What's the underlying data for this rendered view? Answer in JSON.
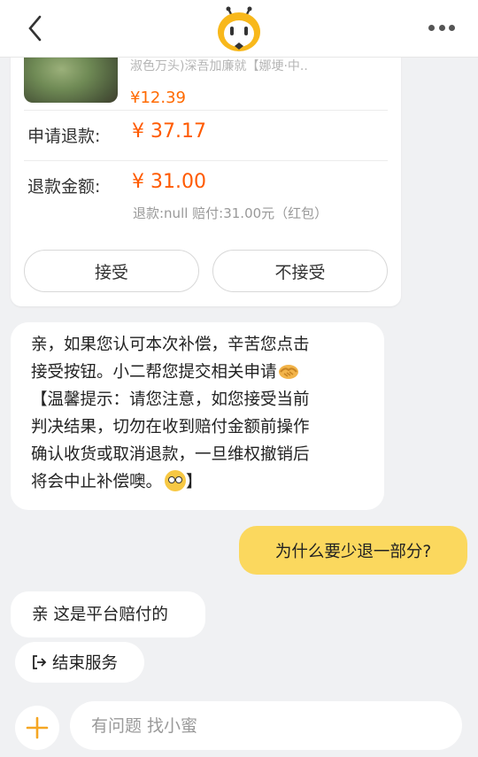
{
  "header": {
    "back_icon": "chevron-left-icon",
    "mascot_icon": "xiaomi-mascot-icon",
    "more_icon": "more-dots-icon"
  },
  "refund_card": {
    "product_title": "淑色万头)深吾加廉就【娜埂·中..",
    "product_price": "¥12.39",
    "apply_label": "申请退款:",
    "apply_value": "¥ 37.17",
    "amount_label": "退款金额:",
    "amount_value": "¥ 31.00",
    "amount_note": "退款:null 赔付:31.00元（红包）",
    "accept_label": "接受",
    "reject_label": "不接受"
  },
  "messages": {
    "bot_1_line_1": "亲，如果您认可本次补偿，辛苦您点击",
    "bot_1_line_2": "接受按钮。小二帮您提交相关申请",
    "bot_1_line_3": "【温馨提示：请您注意，如您接受当前",
    "bot_1_line_4": "判决结果，切勿在收到赔付金额前操作",
    "bot_1_line_5": "确认收货或取消退款，一旦维权撤销后",
    "bot_1_line_6": "将会中止补偿噢。",
    "bot_1_close": "】",
    "user_1": "为什么要少退一部分?",
    "bot_2": "亲 这是平台赔付的"
  },
  "end_service": {
    "label": "结束服务",
    "icon": "exit-icon"
  },
  "input_bar": {
    "placeholder": "有问题 找小蜜",
    "plus_icon": "plus-icon"
  },
  "colors": {
    "accent_orange": "#ff5a00",
    "user_bubble": "#fbd85e",
    "background": "#f0f1f3"
  }
}
